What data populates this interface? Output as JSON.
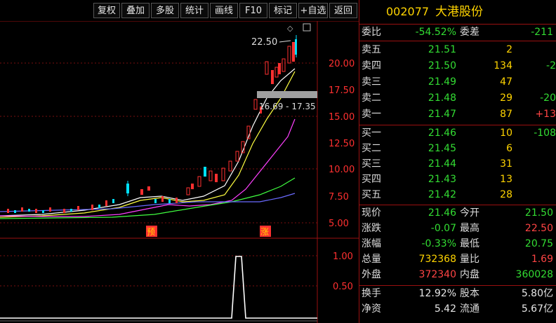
{
  "toolbar": {
    "buttons": [
      "复权",
      "叠加",
      "多股",
      "统计",
      "画线",
      "F10",
      "标记",
      "+自选",
      "返回"
    ]
  },
  "chart": {
    "price_axis": [
      "20.00",
      "17.50",
      "15.00",
      "12.50",
      "10.00",
      "7.50",
      "5.00"
    ],
    "indicator_axis": [
      "1.00",
      "0.50"
    ],
    "high_label": "22.50",
    "range_label": "16.69 - 17.35",
    "markers": [
      "预",
      "涨"
    ],
    "colors": {
      "up": "#ff3030",
      "down": "#00e0ff",
      "ma5": "#ffffff",
      "ma10": "#ffff40",
      "ma20": "#ff40ff",
      "ma60": "#40ff40",
      "ma120": "#6a6aff"
    }
  },
  "chart_data": {
    "type": "candlestick",
    "ylim": [
      4.4,
      24.0
    ],
    "yticks": [
      20.0,
      17.5,
      15.0,
      12.5,
      10.0,
      7.5,
      5.0
    ],
    "high": 22.5,
    "band": [
      16.69,
      17.35
    ],
    "series": [],
    "indicator": {
      "ylim": [
        0,
        1.2
      ],
      "yticks": [
        1.0,
        0.5
      ]
    }
  },
  "quote": {
    "code": "002077",
    "name": "大港股份",
    "weibi_label": "委比",
    "weibi": "-54.52%",
    "weicha_label": "委差",
    "weicha": "-211",
    "asks": [
      {
        "label": "卖五",
        "price": "21.51",
        "vol": "2",
        "chg": ""
      },
      {
        "label": "卖四",
        "price": "21.50",
        "vol": "134",
        "chg": "-2"
      },
      {
        "label": "卖三",
        "price": "21.49",
        "vol": "47",
        "chg": ""
      },
      {
        "label": "卖二",
        "price": "21.48",
        "vol": "29",
        "chg": "-20"
      },
      {
        "label": "卖一",
        "price": "21.47",
        "vol": "87",
        "chg": "+13"
      }
    ],
    "bids": [
      {
        "label": "买一",
        "price": "21.46",
        "vol": "10",
        "chg": "-108"
      },
      {
        "label": "买二",
        "price": "21.45",
        "vol": "6",
        "chg": ""
      },
      {
        "label": "买三",
        "price": "21.44",
        "vol": "31",
        "chg": ""
      },
      {
        "label": "买四",
        "price": "21.43",
        "vol": "13",
        "chg": ""
      },
      {
        "label": "买五",
        "price": "21.42",
        "vol": "28",
        "chg": ""
      }
    ],
    "stats": [
      {
        "l1": "现价",
        "v1": "21.46",
        "c1": "green",
        "l2": "今开",
        "v2": "21.50",
        "c2": "green"
      },
      {
        "l1": "涨跌",
        "v1": "-0.07",
        "c1": "green",
        "l2": "最高",
        "v2": "22.50",
        "c2": "red"
      },
      {
        "l1": "涨幅",
        "v1": "-0.33%",
        "c1": "green",
        "l2": "最低",
        "v2": "20.75",
        "c2": "green"
      },
      {
        "l1": "总量",
        "v1": "732368",
        "c1": "yellow",
        "l2": "量比",
        "v2": "1.69",
        "c2": "red"
      },
      {
        "l1": "外盘",
        "v1": "372340",
        "c1": "red",
        "l2": "内盘",
        "v2": "360028",
        "c2": "green"
      }
    ],
    "stats2": [
      {
        "l1": "换手",
        "v1": "12.92%",
        "l2": "股本",
        "v2": "5.80亿"
      },
      {
        "l1": "净资",
        "v1": "5.42",
        "l2": "流通",
        "v2": "5.67亿"
      }
    ]
  }
}
